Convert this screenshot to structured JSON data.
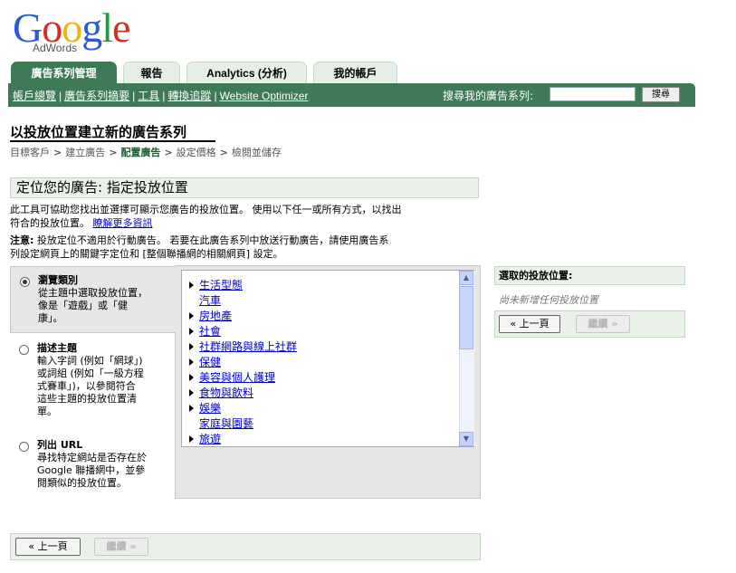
{
  "logo": {
    "text": "Google",
    "sub": "AdWords"
  },
  "tabs": [
    {
      "label": "廣告系列管理",
      "active": true
    },
    {
      "label": "報告"
    },
    {
      "label": "Analytics (分析)"
    },
    {
      "label": "我的帳戶"
    }
  ],
  "subnav": {
    "links": [
      "帳戶總覽",
      "廣告系列摘要",
      "工具",
      "轉換追蹤",
      "Website Optimizer"
    ],
    "separator": "|",
    "search_label": "搜尋我的廣告系列:",
    "search_value": "",
    "search_button": "搜尋"
  },
  "page_title": "以投放位置建立新的廣告系列",
  "breadcrumb": {
    "steps": [
      "目標客戶",
      "建立廣告",
      "配置廣告",
      "設定價格",
      "檢閱並儲存"
    ],
    "current_index": 2,
    "arrow": ">"
  },
  "section": {
    "header": "定位您的廣告:  指定投放位置",
    "intro_line1": "此工具可協助您找出並選擇可顯示您廣告的投放位置。 使用以下任一或所有方式，以找出",
    "intro_line2": "符合的投放位置。",
    "learn_more": "瞭解更多資訊",
    "note_label": "注意:",
    "note_line1": "投放定位不適用於行動廣告。 若要在此廣告系列中放送行動廣告，請使用廣告系",
    "note_line2": "列設定網頁上的關鍵字定位和 [整個聯播網的相關網頁] 設定。"
  },
  "options": [
    {
      "title": "瀏覽類別",
      "desc": [
        "從主題中選取投放位置，",
        "像是「遊戲」或「健",
        "康」。"
      ],
      "selected": true
    },
    {
      "title": "描述主題",
      "desc": [
        "輸入字詞 (例如「網球」)",
        "或詞組 (例如「一級方程",
        "式賽車」)，以參閱符合",
        "這些主題的投放位置清",
        "單。"
      ],
      "selected": false
    },
    {
      "title": "列出 URL",
      "desc": [
        "尋找特定網站是否存在於",
        "Google 聯播網中，並參",
        "閱類似的投放位置。"
      ],
      "selected": false
    }
  ],
  "categories": [
    {
      "label": "生活型態",
      "expandable": true
    },
    {
      "label": "汽車",
      "expandable": false
    },
    {
      "label": "房地產",
      "expandable": true
    },
    {
      "label": "社會",
      "expandable": true
    },
    {
      "label": "社群網路與線上社群",
      "expandable": true
    },
    {
      "label": "保健",
      "expandable": true
    },
    {
      "label": "美容與個人護理",
      "expandable": true
    },
    {
      "label": "食物與飲料",
      "expandable": true
    },
    {
      "label": "娛樂",
      "expandable": true
    },
    {
      "label": "家庭與園藝",
      "expandable": false
    },
    {
      "label": "旅遊",
      "expandable": true
    }
  ],
  "selected_panel": {
    "header": "選取的投放位置:",
    "empty_text": "尚未新增任何投放位置"
  },
  "buttons": {
    "prev": "« 上一頁",
    "next": "繼續 »"
  },
  "colors": {
    "nav_green": "#3d7a55",
    "link_blue": "#0000cc",
    "panel_green": "#e9f1e9"
  }
}
